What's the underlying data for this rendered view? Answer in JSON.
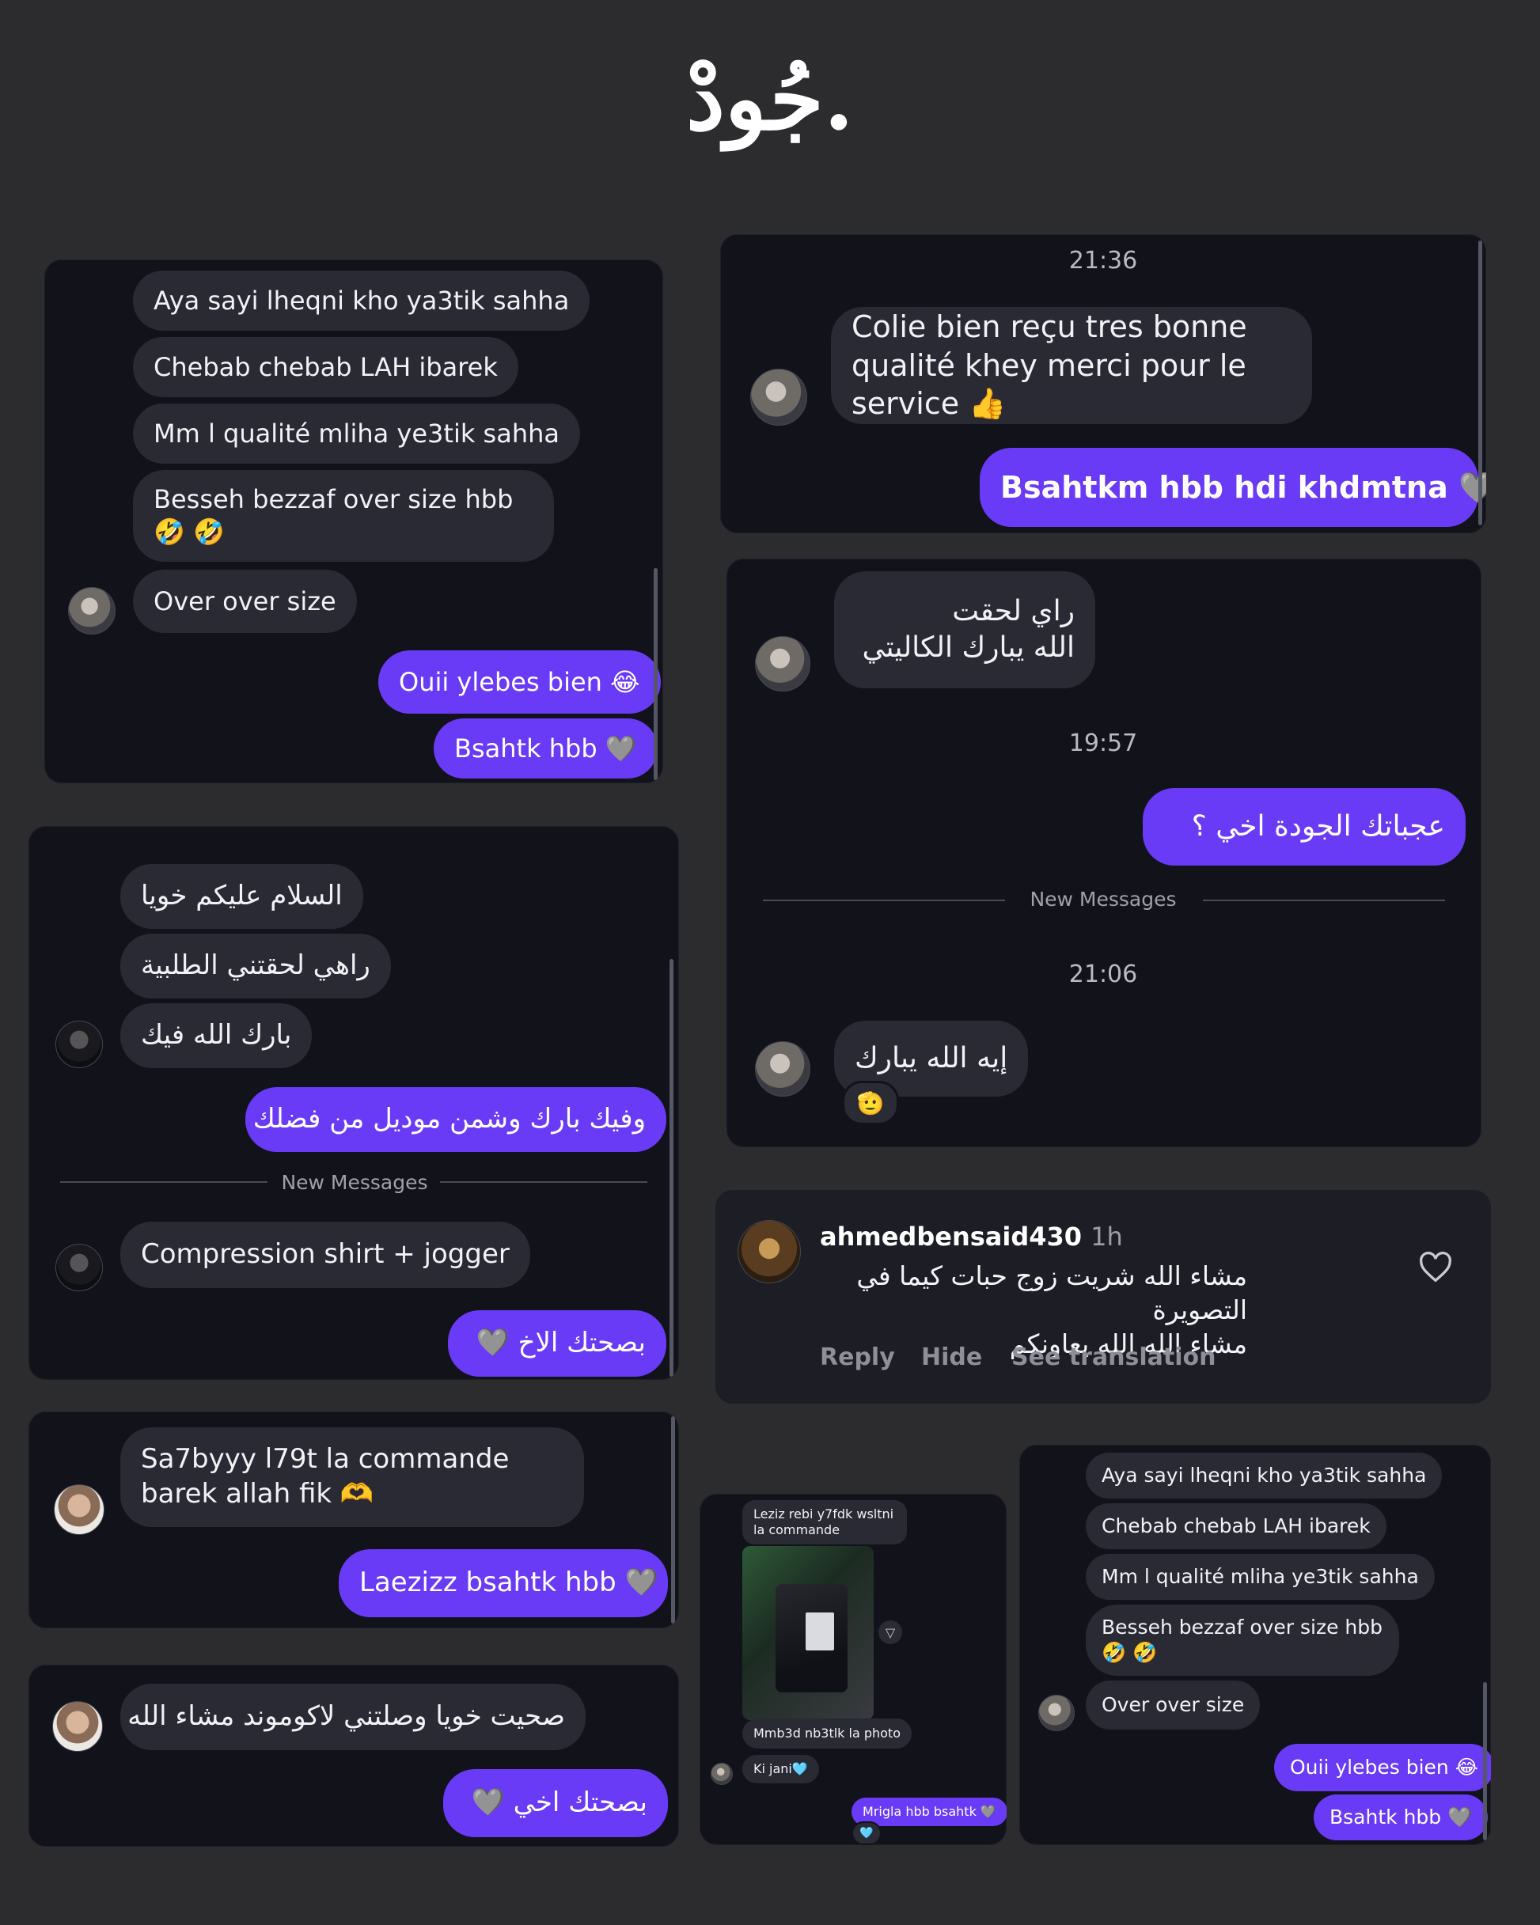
{
  "header": {
    "logo": "جُودْ."
  },
  "card1": {
    "messages_in": [
      "Aya sayi lheqni kho ya3tik sahha",
      "Chebab chebab LAH ibarek",
      "Mm l qualité mliha ye3tik sahha",
      "Besseh bezzaf over size hbb 🤣 🤣",
      "Over over size"
    ],
    "messages_out": [
      "Ouii ylebes bien 😂",
      "Bsahtk hbb 🩶"
    ]
  },
  "card2": {
    "time": "21:36",
    "message_in": "Colie bien reçu tres bonne qualité khey merci pour le service 👍",
    "message_out": "Bsahtkm hbb hdi khdmtna 🩶"
  },
  "card3": {
    "messages_in": [
      "السلام عليكم خويا",
      "راهي لحقتني الطلبية",
      "بارك الله فيك"
    ],
    "message_out_1": "وفيك بارك وشمن موديل من فضلك",
    "divider": "New Messages",
    "message_in_2": "Compression shirt + jogger",
    "message_out_2": "بصحتك الاخ 🩶"
  },
  "card4": {
    "message_in": "راي لحقت\nالله يبارك الكاليتي",
    "time1": "19:57",
    "message_out": "عجباتك الجودة اخي ؟",
    "divider": "New Messages",
    "time2": "21:06",
    "message_in_2": "إيه الله يبارك",
    "reaction": "🫡"
  },
  "card5": {
    "message_in": "Sa7byyy l79t la commande barek allah fik 🫶",
    "message_out": "Laezizz bsahtk hbb 🩶"
  },
  "card6": {
    "message_in": "صحيت خويا وصلتني لاكوموند مشاء الله",
    "message_out": "بصحتك اخي 🩶"
  },
  "comment": {
    "username": "ahmedbensaid430",
    "time": "1h",
    "text": "مشاء الله شريت زوج حبات كيما في التصويرة\nمشاء الله الله يعاونكم",
    "actions": [
      "Reply",
      "Hide",
      "See translation"
    ]
  },
  "card7": {
    "message_top": "Leziz rebi y7fdk wsltni la commande",
    "message_mid": "Mmb3d nb3tlk la photo",
    "message_small": "Ki jani🩵",
    "message_out": "Mrigla hbb bsahtk 🩶",
    "reaction": "🩵"
  },
  "card8": {
    "messages_in": [
      "Aya sayi lheqni kho ya3tik sahha",
      "Chebab chebab LAH ibarek",
      "Mm l qualité mliha ye3tik sahha",
      "Besseh bezzaf over size hbb 🤣 🤣",
      "Over over size"
    ],
    "messages_out": [
      "Ouii ylebes bien 😂",
      "Bsahtk hbb 🩶"
    ]
  }
}
